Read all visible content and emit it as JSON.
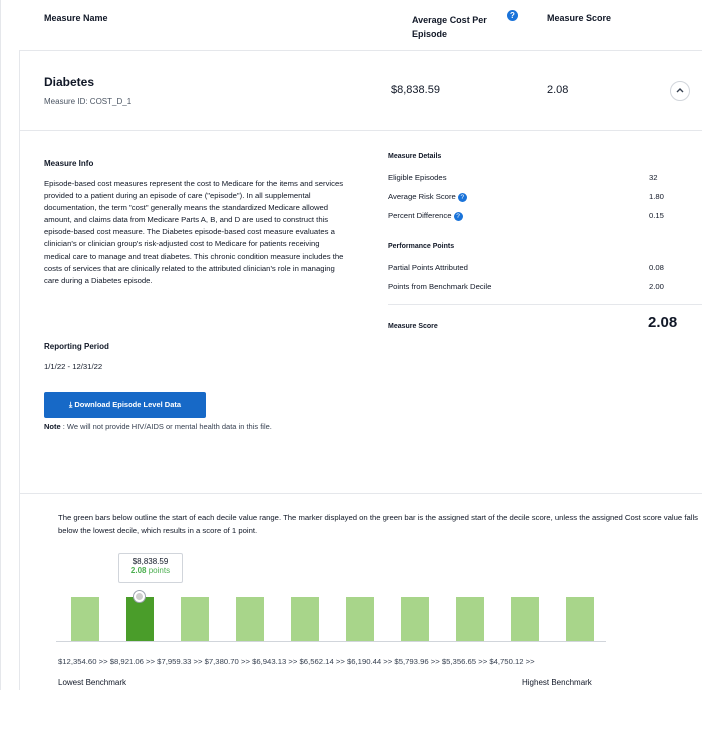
{
  "header": {
    "measure_name": "Measure Name",
    "avg_cost": "Average Cost Per Episode",
    "help_glyph": "?",
    "measure_score": "Measure Score"
  },
  "measure": {
    "title": "Diabetes",
    "id_label": "Measure ID: COST_D_1",
    "avg_cost_value": "$8,838.59",
    "score_value": "2.08",
    "collapse_glyph": "^"
  },
  "info": {
    "heading": "Measure Info",
    "text": "Episode-based cost measures represent the cost to Medicare for the items and services provided to a patient during an episode of care (\"episode\"). In all supplemental documentation, the term \"cost\" generally means the standardized Medicare allowed amount, and claims data from Medicare Parts A, B, and D are used to construct this episode-based cost measure. The Diabetes episode-based cost measure evaluates a clinician's or clinician group's risk-adjusted cost to Medicare for patients receiving medical care to manage and treat diabetes. This chronic condition measure includes the costs of services that are clinically related to the attributed clinician's role in managing care during a Diabetes episode.",
    "reporting_heading": "Reporting Period",
    "reporting_value": "1/1/22 - 12/31/22",
    "download_label": "⤓ Download Episode Level Data",
    "note_label": "Note",
    "note_text": " : We will not provide HIV/AIDS or mental health data in this file."
  },
  "details": {
    "heading": "Measure Details",
    "eligible_label": "Eligible Episodes",
    "eligible_value": "32",
    "risk_label": "Average Risk Score",
    "risk_value": "1.80",
    "pct_label": "Percent Difference",
    "pct_value": "0.15",
    "perf_heading": "Performance Points",
    "partial_label": "Partial Points Attributed",
    "partial_value": "0.08",
    "bench_label": "Points from Benchmark Decile",
    "bench_value": "2.00",
    "score_label": "Measure Score",
    "score_value": "2.08"
  },
  "decile": {
    "description": "The green bars below outline the start of each decile value range. The marker displayed on the green bar is the assigned start of the decile score, unless the assigned Cost score value falls below the lowest decile, which results in a score of 1 point.",
    "tooltip_value": "$8,838.59",
    "tooltip_points": "2.08",
    "tooltip_points_suffix": " points",
    "tick_labels": "$12,354.60 >>  $8,921.06 >>  $7,959.33 >>  $7,380.70 >>  $6,943.13 >>  $6,562.14 >>  $6,190.44 >>  $5,793.96 >>  $5,356.65 >>  $4,750.12 >>",
    "low_label": "Lowest Benchmark",
    "high_label": "Highest Benchmark",
    "bar_count": 10,
    "selected_bar": 2,
    "colors": {
      "bar": "#a8d58a",
      "selected": "#4a9d2a",
      "button": "#1769c7",
      "help": "#1a73d9"
    }
  }
}
